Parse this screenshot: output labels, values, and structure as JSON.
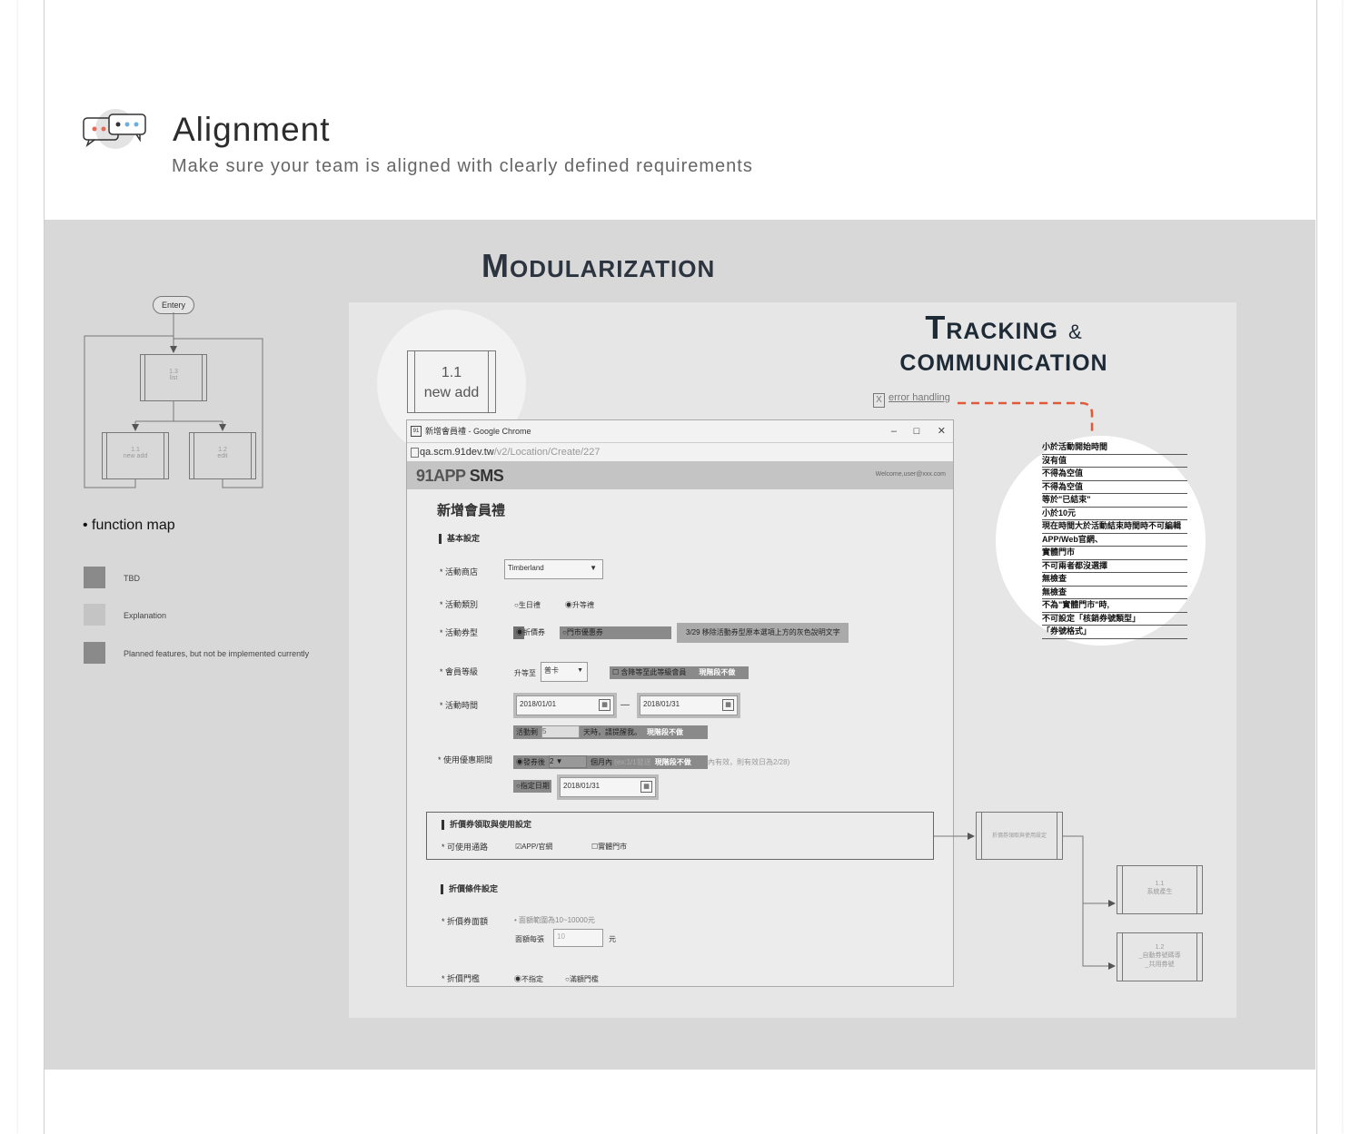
{
  "header": {
    "title": "Alignment",
    "subtitle": "Make sure your team is aligned with clearly defined requirements"
  },
  "section": {
    "title_big": "M",
    "title_rest": "odularization"
  },
  "function_map": {
    "entry": "Entery",
    "list_num": "1.3",
    "list_label": "list",
    "new_num": "1.1",
    "new_label": "new add",
    "edit_num": "1.2",
    "edit_label": "edit",
    "caption": "• function map"
  },
  "legend": [
    {
      "label": "TBD",
      "color": "#8a8a8a"
    },
    {
      "label": "Explanation",
      "color": "#c4c4c4"
    },
    {
      "label": "Planned features, but not be implemented currently",
      "color": "#8a8a8a"
    }
  ],
  "callout_new": {
    "num": "1.1",
    "label": "new add"
  },
  "tracking": {
    "t_big": "T",
    "t_rest": "racking",
    "amp": "&",
    "line2": "communication",
    "error_link": "error handling"
  },
  "error_items": [
    "小於活動開始時間",
    "沒有值",
    "不得為空值",
    "不得為空值",
    "等於\"已結束\"",
    "小於10元",
    "現在時間大於活動結束時間時不可編輯",
    "APP/Web官網、",
    "實體門市",
    "不可兩者都沒選擇",
    "無檢查",
    "無檢查",
    "不為\"實體門市\"時,",
    "不可設定「核銷券號類型」",
    "「券號格式」"
  ],
  "browser": {
    "window_title": "新增會員禮 - Google Chrome",
    "favicon": "91",
    "url_main": "qa.scm.91dev.tw",
    "url_path": "/v2/Location/Create/227",
    "logo_a": "91APP",
    "logo_b": "SMS",
    "welcome": "Welcome,user@xxx.com",
    "minimize": "–",
    "maximize": "☐",
    "close": "✕"
  },
  "form": {
    "title": "新增會員禮",
    "sec_basic": "基本設定",
    "lbl_store": "* 活動商店",
    "store_value": "Timberland",
    "lbl_category": "* 活動類別",
    "opt_birthday": "○生日禮",
    "opt_upgrade": "◉升等禮",
    "lbl_coupon_type": "* 活動券型",
    "opt_discount": "◉折價券",
    "opt_store_coupon": "○門市優惠券",
    "note_coupon": "3/29 移除活動券型原本選項上方的灰色說明文字",
    "lbl_level": "* 會員等級",
    "upgrade_to": "升等至",
    "level_value": "普卡",
    "include_lower": "☐ 含降等至此等級會員",
    "not_now_1": "現階段不做",
    "lbl_time": "* 活動時間",
    "date_start": "2018/01/01",
    "date_dash": "—",
    "date_end": "2018/01/31",
    "remind_prefix": "活動剩",
    "remind_value": "5",
    "remind_suffix": "天時，請提醒我。",
    "not_now_2": "現階段不做",
    "lbl_use_period": "* 使用優惠期間",
    "opt_after_issue": "◉發券後",
    "months_value": "2",
    "months_suffix": "個月內",
    "months_hint": "(ex:1/1發送",
    "not_now_3": "現階段不做",
    "months_hint2": "內有效，則有效日為2/28)",
    "opt_specific_date": "○指定日期",
    "specific_date": "2018/01/31",
    "sec_coupon_use": "折價券領取與使用設定",
    "lbl_channel": "* 可使用通路",
    "chk_app": "☑APP/官網",
    "chk_store": "☐實體門市",
    "sec_conditions": "折價條件設定",
    "lbl_face_value": "* 折價券面額",
    "face_hint": "• 面額範圍為10~10000元",
    "face_each": "面額每張",
    "face_value": "10",
    "face_unit": "元",
    "lbl_threshold": "* 折價門檻",
    "opt_none": "◉不指定",
    "opt_full": "○滿額門檻"
  },
  "side_map": {
    "parent": "折價券領取與使用設定",
    "child1_num": "1.1",
    "child1_label": "系統產生",
    "child2_num": "1.2",
    "child2_label_a": "_自動券號碼導",
    "child2_label_b": "_共用券號"
  }
}
